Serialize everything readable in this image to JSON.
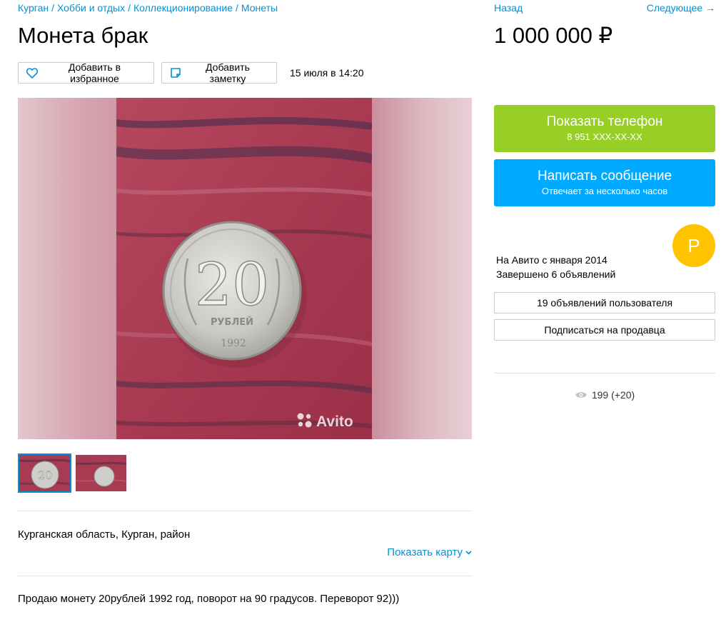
{
  "breadcrumb": {
    "items": [
      "Курган",
      "Хобби и отдых",
      "Коллекционирование",
      "Монеты"
    ],
    "separator": "/"
  },
  "listing": {
    "title": "Монета брак",
    "price": "1 000 000 ₽",
    "date": "15 июля в 14:20",
    "location": "Курганская область, Курган, район",
    "description": "Продаю монету 20рублей 1992 год, поворот на 90 градусов. Переворот 92)))"
  },
  "actions": {
    "favorite_label": "Добавить в избранное",
    "note_label": "Добавить заметку"
  },
  "nav": {
    "back_label": "Назад",
    "next_label": "Следующее →"
  },
  "gallery": {
    "watermark": "Avito",
    "coin_value": "20",
    "coin_text": "РУБЛЕЙ",
    "coin_year": "1992",
    "thumbnail_count": 2,
    "active_index": 0
  },
  "map": {
    "show_label": "Показать карту"
  },
  "contact": {
    "phone_label": "Показать телефон",
    "phone_mask": "8 951 XXX-XX-XX",
    "message_label": "Написать сообщение",
    "message_sub": "Отвечает за несколько часов"
  },
  "seller": {
    "avatar_letter": "P",
    "since": "На Авито с января 2014",
    "completed": "Завершено 6 объявлений",
    "listings_button": "19 объявлений пользователя",
    "subscribe_button": "Подписаться на продавца"
  },
  "stats": {
    "views": "199 (+20)"
  },
  "colors": {
    "link": "#0091d9",
    "phone_button": "#97cf26",
    "message_button": "#00aaff",
    "avatar": "#ffc300"
  }
}
